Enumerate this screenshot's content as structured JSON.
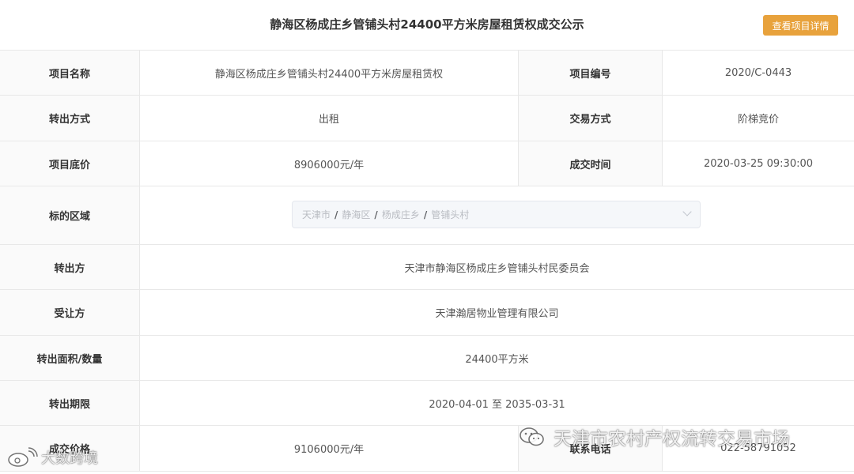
{
  "header": {
    "title": "静海区杨成庄乡管铺头村24400平方米房屋租赁权成交公示",
    "detail_button": "查看项目详情"
  },
  "rows": [
    {
      "label1": "项目名称",
      "value1": "静海区杨成庄乡管铺头村24400平方米房屋租赁权",
      "label2": "项目编号",
      "value2": "2020/C-0443"
    },
    {
      "label1": "转出方式",
      "value1": "出租",
      "label2": "交易方式",
      "value2": "阶梯竞价"
    },
    {
      "label1": "项目底价",
      "value1": "8906000元/年",
      "label2": "成交时间",
      "value2": "2020-03-25 09:30:00"
    }
  ],
  "region": {
    "label": "标的区域",
    "path": [
      "天津市",
      "静海区",
      "杨成庄乡",
      "管铺头村"
    ],
    "separator": "/"
  },
  "wide_rows": [
    {
      "label": "转出方",
      "value": "天津市静海区杨成庄乡管铺头村民委员会"
    },
    {
      "label": "受让方",
      "value": "天津瀚居物业管理有限公司"
    },
    {
      "label": "转出面积/数量",
      "value": "24400平方米"
    },
    {
      "label": "转出期限",
      "value": "2020-04-01 至 2035-03-31"
    }
  ],
  "deal_row": {
    "label1": "成交价格",
    "value1": "9106000元/年",
    "label2": "联系电话",
    "value2": "022-58791052"
  },
  "watermarks": {
    "wechat_text": "天津市农村产权流转交易市场",
    "weibo_text": "大数跨境"
  }
}
